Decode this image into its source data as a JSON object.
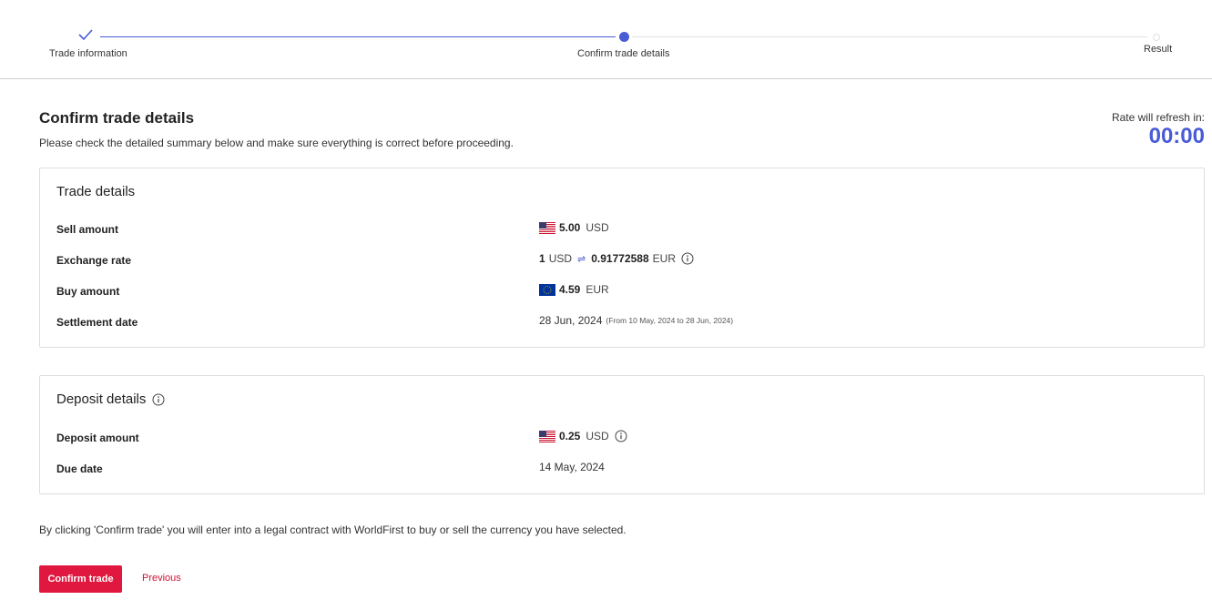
{
  "stepper": {
    "steps": [
      {
        "label": "Trade information",
        "state": "done",
        "icon": "check-icon"
      },
      {
        "label": "Confirm trade details",
        "state": "current"
      },
      {
        "label": "Result",
        "state": "pending"
      }
    ]
  },
  "header": {
    "title": "Confirm trade details",
    "subtitle": "Please check the detailed summary below and make sure everything is correct before proceeding.",
    "refresh_label": "Rate will refresh in:",
    "timer": "00:00"
  },
  "trade_details": {
    "title": "Trade details",
    "sell": {
      "label": "Sell amount",
      "amount": "5.00",
      "currency": "USD",
      "flag": "us-flag-icon"
    },
    "rate": {
      "label": "Exchange rate",
      "from_amount": "1",
      "from_currency": "USD",
      "to_amount": "0.91772588",
      "to_currency": "EUR"
    },
    "buy": {
      "label": "Buy amount",
      "amount": "4.59",
      "currency": "EUR",
      "flag": "eu-flag-icon"
    },
    "settlement": {
      "label": "Settlement date",
      "date": "28 Jun, 2024",
      "range": "(From 10 May, 2024 to 28 Jun, 2024)"
    }
  },
  "deposit_details": {
    "title": "Deposit details",
    "amount": {
      "label": "Deposit amount",
      "amount": "0.25",
      "currency": "USD",
      "flag": "us-flag-icon"
    },
    "due": {
      "label": "Due date",
      "date": "14 May, 2024"
    }
  },
  "legal_text": "By clicking 'Confirm trade' you will enter into a legal contract with WorldFirst to buy or sell the currency you have selected.",
  "actions": {
    "confirm": "Confirm trade",
    "previous": "Previous"
  },
  "colors": {
    "accent": "#4a5bd6",
    "primary_button": "#e0173f",
    "link": "#d01236"
  }
}
